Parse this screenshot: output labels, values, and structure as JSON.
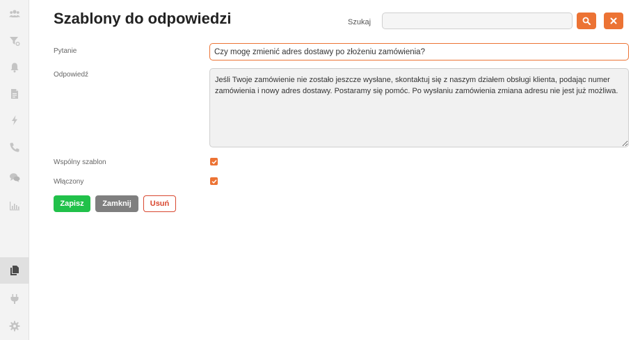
{
  "page": {
    "title": "Szablony do odpowiedzi"
  },
  "search": {
    "label": "Szukaj",
    "value": "",
    "placeholder": ""
  },
  "form": {
    "question_label": "Pytanie",
    "question_value": "Czy mogę zmienić adres dostawy po złożeniu zamówienia?",
    "answer_label": "Odpowiedź",
    "answer_value": "Jeśli Twoje zamówienie nie zostało jeszcze wysłane, skontaktuj się z naszym działem obsługi klienta, podając numer zamówienia i nowy adres dostawy. Postaramy się pomóc. Po wysłaniu zamówienia zmiana adresu nie jest już możliwa.",
    "shared_label": "Wspólny szablon",
    "shared_checked": true,
    "enabled_label": "Włączony",
    "enabled_checked": true
  },
  "actions": {
    "save_label": "Zapisz",
    "close_label": "Zamknij",
    "delete_label": "Usuń"
  },
  "sidebar": {
    "items": [
      {
        "icon": "users-icon"
      },
      {
        "icon": "filter-icon"
      },
      {
        "icon": "bell-icon"
      },
      {
        "icon": "document-icon"
      },
      {
        "icon": "lightning-icon"
      },
      {
        "icon": "phone-icon"
      },
      {
        "icon": "chat-icon"
      },
      {
        "icon": "bar-chart-icon"
      },
      {
        "icon": "copy-icon",
        "active": true
      },
      {
        "icon": "plug-icon"
      },
      {
        "icon": "gear-icon"
      }
    ]
  },
  "colors": {
    "accent": "#ec7334",
    "save": "#21c14a",
    "close": "#7f7f7f",
    "delete": "#d9472f",
    "sidebar_icon": "#c4c4c4"
  }
}
